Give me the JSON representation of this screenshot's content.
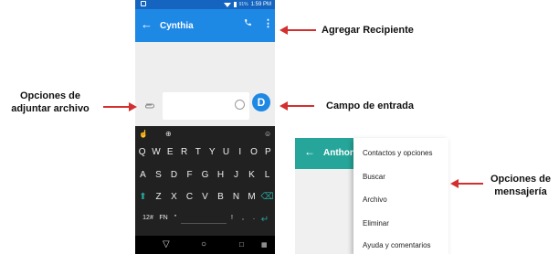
{
  "status_bar": {
    "battery": "91%",
    "time": "1:59 PM"
  },
  "conversation": {
    "back_icon": "←",
    "contact_name": "Cynthia",
    "call_icon": "phone-icon",
    "more_icon": "⋮"
  },
  "composer": {
    "attach_icon": "paperclip-icon",
    "send_label": "D"
  },
  "keyboard": {
    "top_icons": [
      "hand-icon",
      "globe-icon",
      "emoji-icon"
    ],
    "row1": [
      "Q",
      "W",
      "E",
      "R",
      "T",
      "Y",
      "U",
      "I",
      "O",
      "P"
    ],
    "row2": [
      "A",
      "S",
      "D",
      "F",
      "G",
      "H",
      "J",
      "K",
      "L"
    ],
    "row3": [
      "Z",
      "X",
      "C",
      "V",
      "B",
      "N",
      "M"
    ],
    "row4": {
      "symbols": "12#",
      "fn": "FN",
      "quote": "\"",
      "exclam": "!",
      "comma": ",",
      "period": ".",
      "enter": "↵"
    }
  },
  "nav_bar": [
    "back-icon",
    "home-icon",
    "recents-icon",
    "keyboard-icon"
  ],
  "callouts": {
    "add_recipient": "Agregar Recipiente",
    "attach_options_line1": "Opciones de",
    "attach_options_line2": "adjuntar archivo",
    "input_field": "Campo de entrada",
    "messaging_options_line1": "Opciones de",
    "messaging_options_line2": "mensajería"
  },
  "menu_screen": {
    "back_icon": "←",
    "contact_name_partial": "Anthon",
    "menu_items": [
      "Contactos y opciones",
      "Buscar",
      "Archivo",
      "Eliminar",
      "Ayuda y comentarios"
    ]
  },
  "colors": {
    "app_bar": "#1e88e5",
    "status_bar": "#1565c0",
    "menu_app_bar": "#26a69a",
    "arrow": "#d32f2f",
    "keyboard": "#212121"
  }
}
